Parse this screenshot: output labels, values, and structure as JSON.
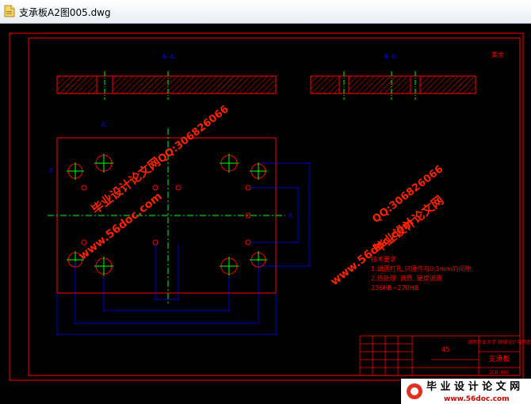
{
  "window": {
    "title": "支承板A2图005.dwg",
    "file_icon": "dwg-file-icon"
  },
  "drawing": {
    "section_aa_label": "A-A",
    "section_bb_label": "B-B",
    "roughness_note": "其余",
    "section_mark_a": "A",
    "section_mark_b": "B",
    "tech_requirements": {
      "heading": "技术要求",
      "line1": "1.调质钉孔,只用作与0.5mm的间隙;",
      "line2": "2.热处理: 调质, 硬度调质",
      "line3": "236HB~270HB."
    },
    "title_block": {
      "material": "45",
      "part_name": "支承板",
      "school": "湖南农业大学\n机械设计与制造",
      "drawing_no": "ZCB-005"
    }
  },
  "watermarks": {
    "site_cn": "毕业设计论文网",
    "site_url": "www.56doc.com",
    "qq": "QQ:306826066",
    "footer_cn": "毕 业 设 计 论 文 网",
    "footer_url": "www.56doc.com"
  },
  "colors": {
    "background": "#000000",
    "border": "#ff0000",
    "hatch": "#ff0000",
    "centerline": "#00ff00",
    "dimension": "#0000ff",
    "text_cad": "#ff0000",
    "watermark": "#ff2200"
  }
}
